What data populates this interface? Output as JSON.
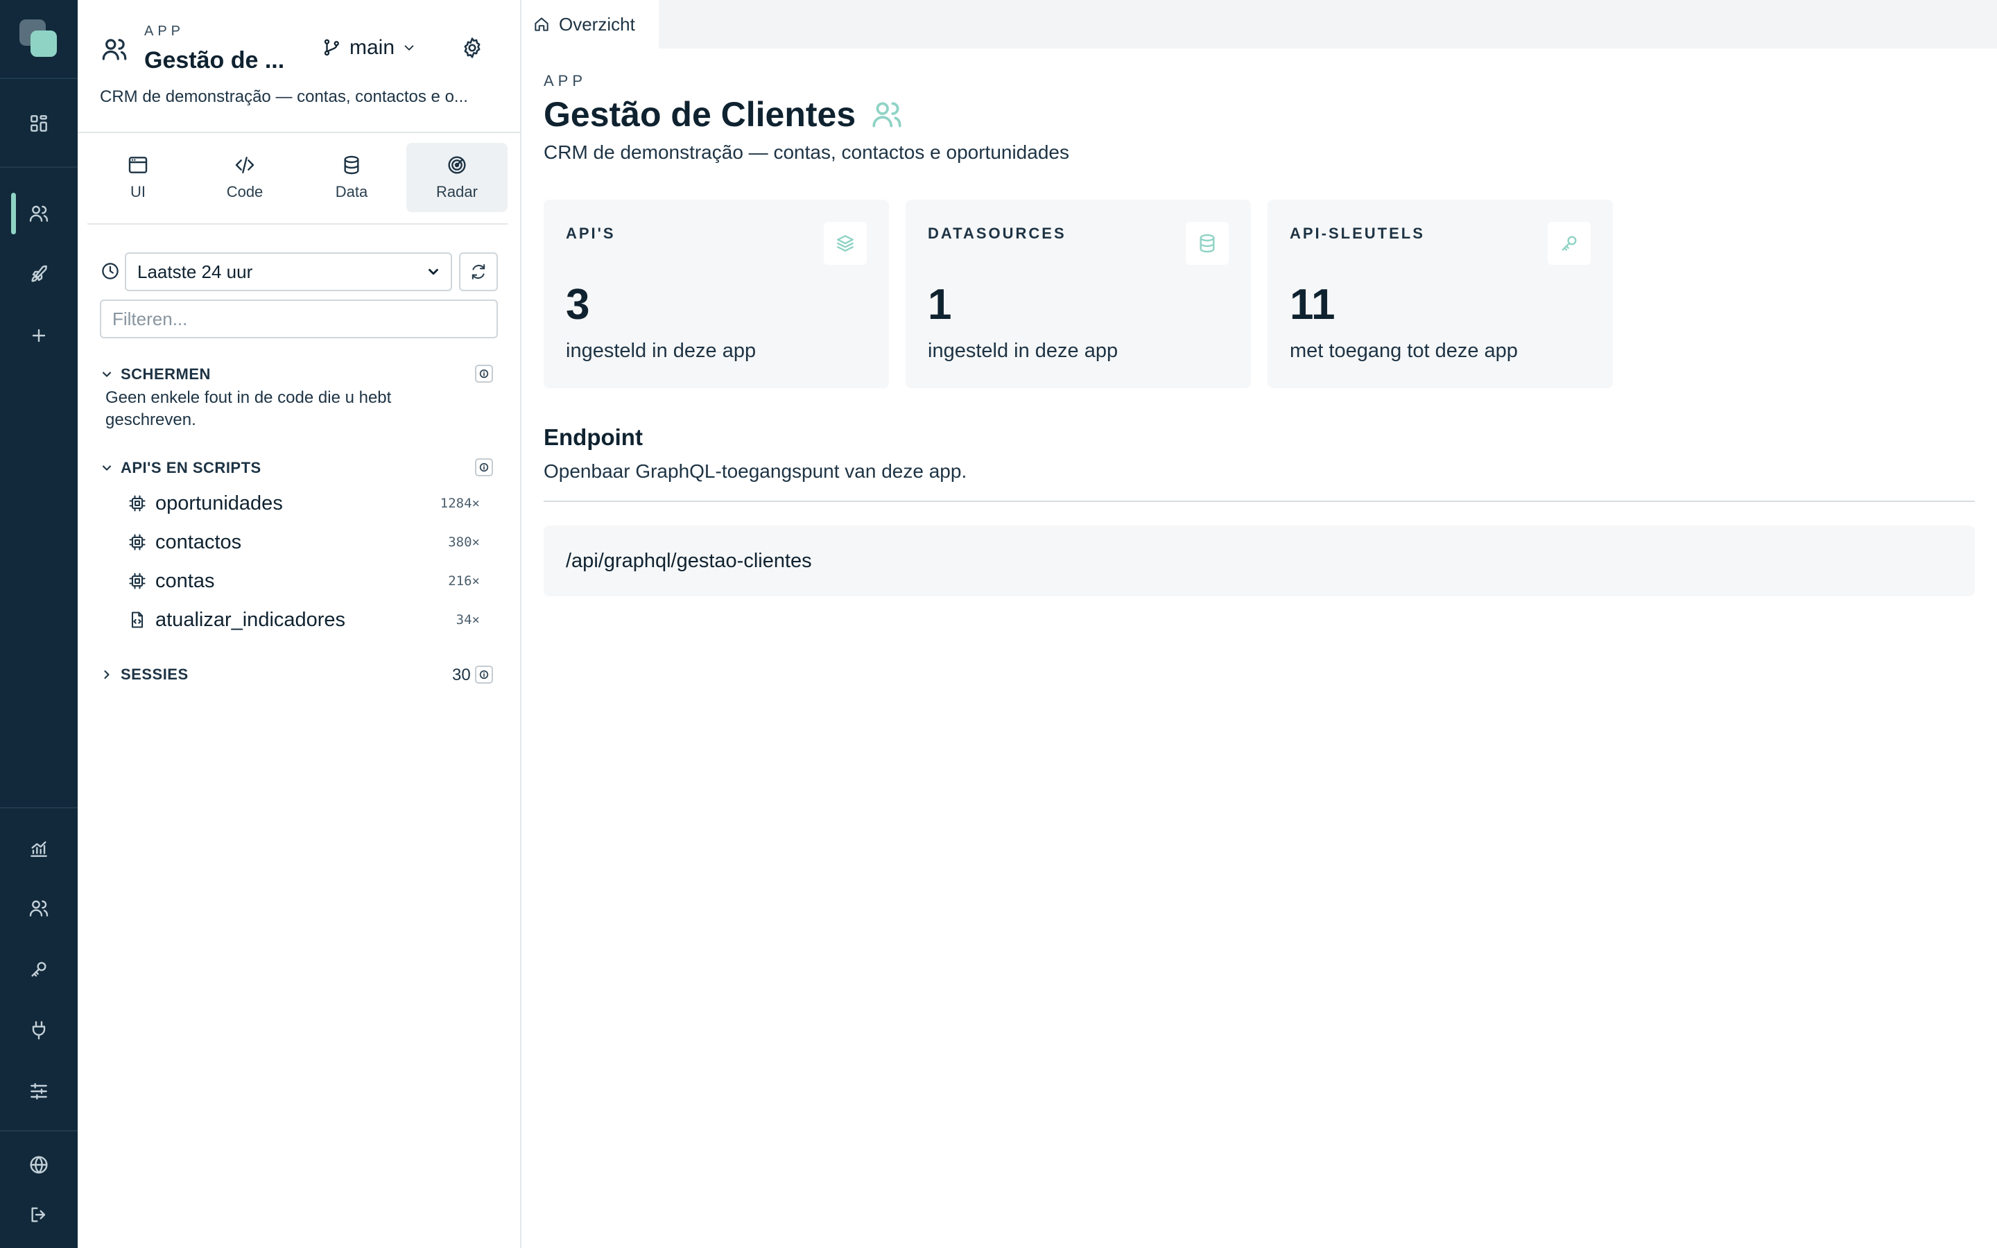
{
  "sidebar": {
    "eyebrow": "APP",
    "title": "Gestão de ...",
    "branch": "main",
    "description": "CRM de demonstração — contas, contactos e o...",
    "tabs": [
      {
        "label": "UI"
      },
      {
        "label": "Code"
      },
      {
        "label": "Data"
      },
      {
        "label": "Radar",
        "active": true
      }
    ],
    "time_range": "Laatste 24 uur",
    "filter_placeholder": "Filteren...",
    "sections": {
      "screens": {
        "title": "SCHERMEN",
        "message": "Geen enkele fout in de code die u hebt geschreven."
      },
      "apis": {
        "title": "API'S EN SCRIPTS",
        "items": [
          {
            "name": "oportunidades",
            "count": "1284×",
            "icon": "chip-icon"
          },
          {
            "name": "contactos",
            "count": "380×",
            "icon": "chip-icon"
          },
          {
            "name": "contas",
            "count": "216×",
            "icon": "chip-icon"
          },
          {
            "name": "atualizar_indicadores",
            "count": "34×",
            "icon": "script-file-icon"
          }
        ]
      },
      "sessions": {
        "title": "SESSIES",
        "count": "30"
      }
    }
  },
  "tab": {
    "label": "Overzicht"
  },
  "main": {
    "eyebrow": "APP",
    "title": "Gestão de Clientes",
    "description": "CRM de demonstração — contas, contactos e oportunidades",
    "cards": [
      {
        "label": "API'S",
        "value": "3",
        "sub": "ingesteld in deze app",
        "icon": "layers-icon"
      },
      {
        "label": "DATASOURCES",
        "value": "1",
        "sub": "ingesteld in deze app",
        "icon": "database-icon"
      },
      {
        "label": "API-SLEUTELS",
        "value": "11",
        "sub": "met toegang tot deze app",
        "icon": "key-icon"
      }
    ],
    "endpoint": {
      "title": "Endpoint",
      "description": "Openbaar GraphQL-toegangspunt van deze app.",
      "path": "/api/graphql/gestao-clientes"
    }
  },
  "colors": {
    "rail": "#11293a",
    "accent": "#8fd3c5",
    "card": "#f6f7f8"
  }
}
